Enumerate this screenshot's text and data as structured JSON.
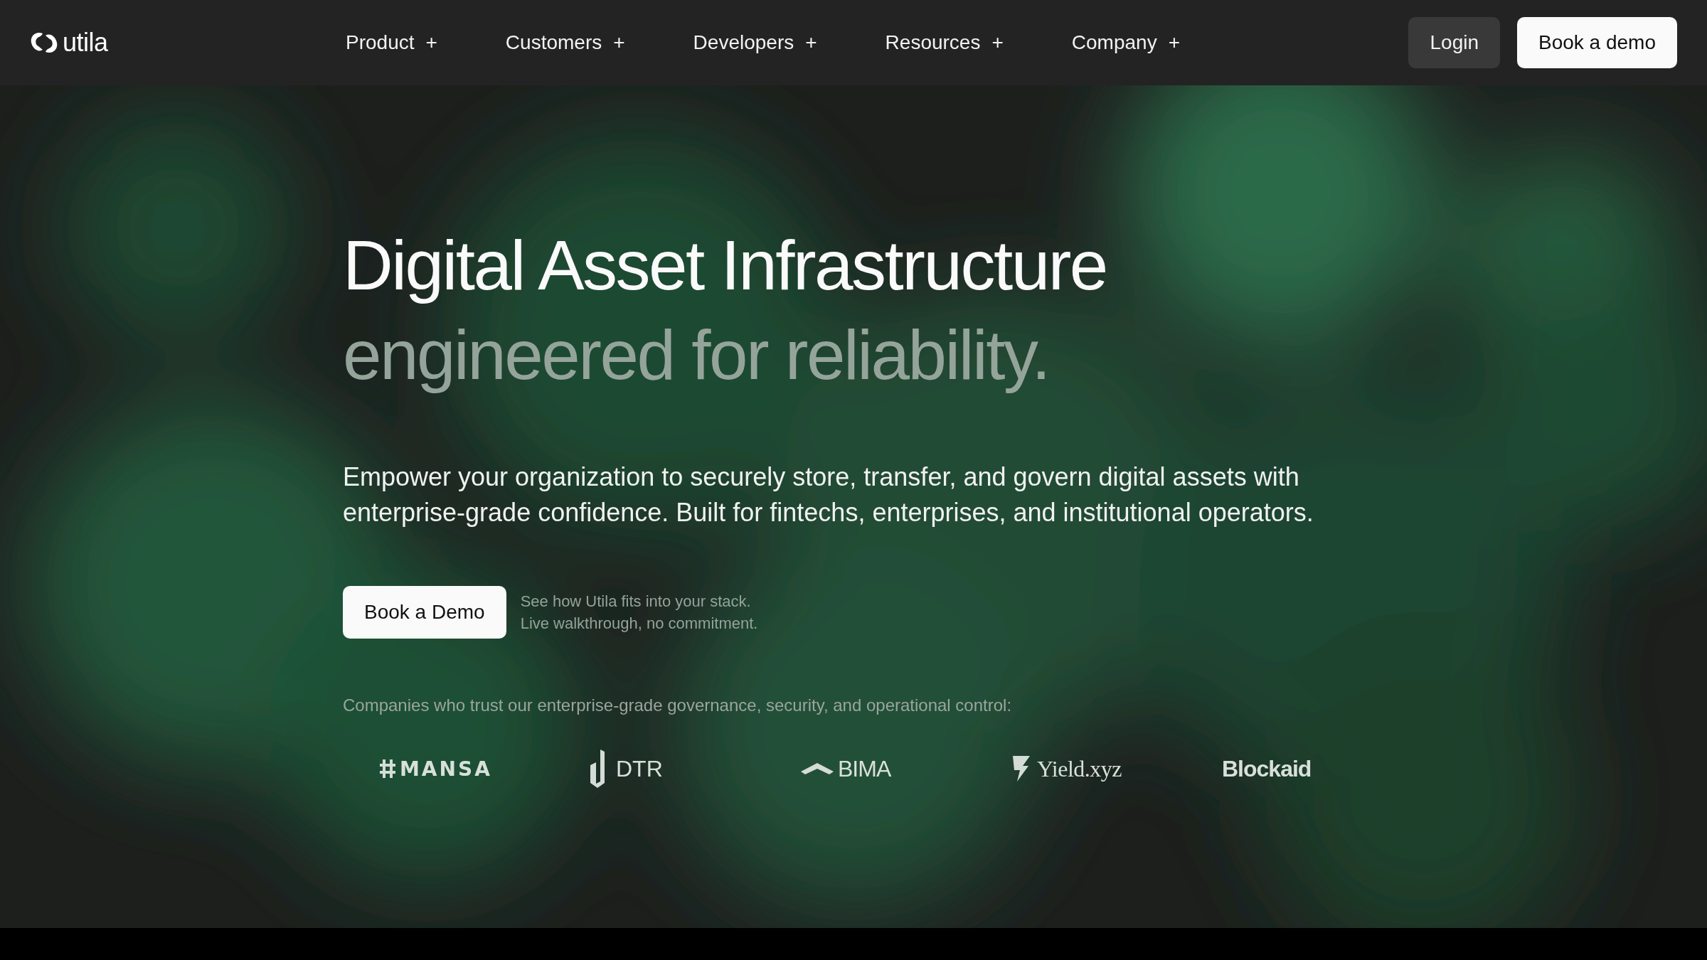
{
  "brand": {
    "name": "utila"
  },
  "nav": [
    {
      "label": "Product",
      "expand": "+"
    },
    {
      "label": "Customers",
      "expand": "+"
    },
    {
      "label": "Developers",
      "expand": "+"
    },
    {
      "label": "Resources",
      "expand": "+"
    },
    {
      "label": "Company",
      "expand": "+"
    }
  ],
  "actions": [
    {
      "kind": "secondary",
      "label": "Login"
    },
    {
      "kind": "primary",
      "label": "Book a demo"
    }
  ],
  "hero": {
    "title": "Digital Asset Infrastructure",
    "subtitle": "engineered for reliability.",
    "description": "Empower your organization to securely store, transfer, and govern digital assets with enterprise-grade confidence. Built for fintechs, enterprises, and institutional operators.",
    "cta": {
      "label": "Book a Demo",
      "note": [
        "See how Utila fits into your stack.",
        "Live walkthrough, no commitment."
      ]
    }
  },
  "trust": {
    "caption": "Companies who trust our enterprise-grade governance, security, and operational control:",
    "logos": [
      {
        "kind": "mansa",
        "name": "MANSA"
      },
      {
        "kind": "dtr",
        "name": "DTR"
      },
      {
        "kind": "bima",
        "name": "BIMA"
      },
      {
        "kind": "yield",
        "name": "Yield.xyz"
      },
      {
        "kind": "blockaid",
        "name": "Blockaid"
      }
    ]
  }
}
